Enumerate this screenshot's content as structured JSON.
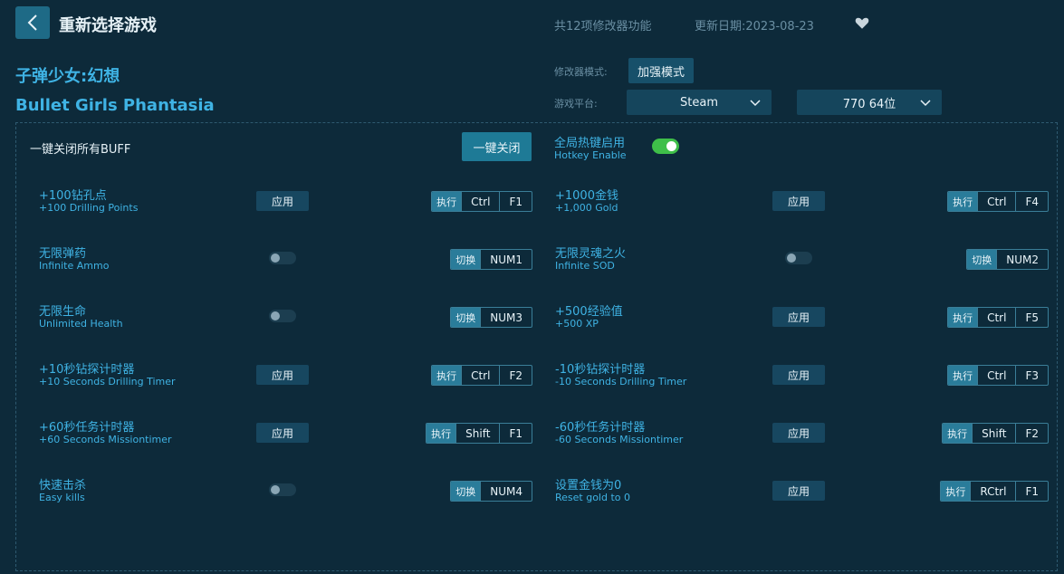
{
  "header": {
    "title": "重新选择游戏",
    "feature_count": "共12项修改器功能",
    "update_date": "更新日期:2023-08-23"
  },
  "game": {
    "name_cn": "子弹少女:幻想",
    "name_en": "Bullet Girls Phantasia"
  },
  "settings": {
    "mode_label": "修改器模式:",
    "mode_value": "加强模式",
    "platform_label": "游戏平台:",
    "platform_value": "Steam",
    "version_value": "770 64位"
  },
  "controls": {
    "all_off_label": "一键关闭所有BUFF",
    "all_off_button": "一键关闭",
    "hotkey_cn": "全局热键启用",
    "hotkey_en": "Hotkey Enable"
  },
  "cheats": [
    {
      "cn": "+100钻孔点",
      "en": "+100 Drilling Points",
      "control": "应用",
      "action": "执行",
      "keys": [
        "Ctrl",
        "F1"
      ]
    },
    {
      "cn": "+1000金钱",
      "en": "+1,000 Gold",
      "control": "应用",
      "action": "执行",
      "keys": [
        "Ctrl",
        "F4"
      ]
    },
    {
      "cn": "无限弹药",
      "en": "Infinite Ammo",
      "action": "切换",
      "keys": [
        "NUM1"
      ]
    },
    {
      "cn": "无限灵魂之火",
      "en": "Infinite SOD",
      "action": "切换",
      "keys": [
        "NUM2"
      ]
    },
    {
      "cn": "无限生命",
      "en": "Unlimited Health",
      "action": "切换",
      "keys": [
        "NUM3"
      ]
    },
    {
      "cn": "+500经验值",
      "en": "+500 XP",
      "control": "应用",
      "action": "执行",
      "keys": [
        "Ctrl",
        "F5"
      ]
    },
    {
      "cn": "+10秒钻探计时器",
      "en": "+10 Seconds Drilling Timer",
      "control": "应用",
      "action": "执行",
      "keys": [
        "Ctrl",
        "F2"
      ]
    },
    {
      "cn": "-10秒钻探计时器",
      "en": "-10 Seconds Drilling Timer",
      "control": "应用",
      "action": "执行",
      "keys": [
        "Ctrl",
        "F3"
      ]
    },
    {
      "cn": "+60秒任务计时器",
      "en": "+60 Seconds Missiontimer",
      "control": "应用",
      "action": "执行",
      "keys": [
        "Shift",
        "F1"
      ]
    },
    {
      "cn": "-60秒任务计时器",
      "en": "-60 Seconds Missiontimer",
      "control": "应用",
      "action": "执行",
      "keys": [
        "Shift",
        "F2"
      ]
    },
    {
      "cn": "快速击杀",
      "en": "Easy kills",
      "action": "切换",
      "keys": [
        "NUM4"
      ]
    },
    {
      "cn": "设置金钱为0",
      "en": "Reset gold to 0",
      "control": "应用",
      "action": "执行",
      "keys": [
        "RCtrl",
        "F1"
      ]
    }
  ],
  "colors": {
    "background": "#0d2a3a",
    "accent_text": "#3fb3e4",
    "button": "#174760",
    "toggle_on": "#3fbf49"
  },
  "icons": {
    "back": "chevron-left-icon",
    "favorite": "heart-icon",
    "dropdown": "chevron-down-icon"
  }
}
